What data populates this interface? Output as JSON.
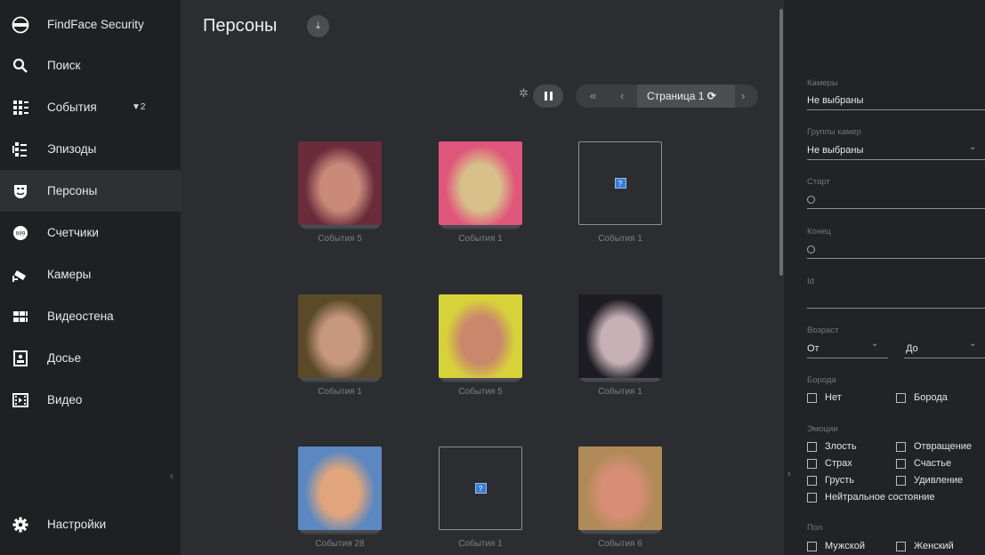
{
  "app": {
    "title": "FindFace Security"
  },
  "sidebar": {
    "items": [
      {
        "label": "Поиск",
        "icon": "search-icon"
      },
      {
        "label": "События",
        "icon": "events-icon",
        "badge": "▼2"
      },
      {
        "label": "Эпизоды",
        "icon": "episodes-icon"
      },
      {
        "label": "Персоны",
        "icon": "persons-icon"
      },
      {
        "label": "Счетчики",
        "icon": "counters-icon"
      },
      {
        "label": "Камеры",
        "icon": "camera-icon"
      },
      {
        "label": "Видеостена",
        "icon": "videowall-icon"
      },
      {
        "label": "Досье",
        "icon": "dossier-icon"
      },
      {
        "label": "Видео",
        "icon": "video-icon"
      }
    ],
    "settings": "Настройки"
  },
  "main": {
    "title": "Персоны",
    "pager": {
      "first": "«",
      "prev": "‹",
      "page": "Страница 1",
      "next": "›"
    },
    "cards": [
      {
        "caption": "События 5",
        "image": true,
        "colors": [
          "#6a2c3a",
          "#c98a7a"
        ]
      },
      {
        "caption": "События 1",
        "image": true,
        "colors": [
          "#e0567a",
          "#d8c08a"
        ]
      },
      {
        "caption": "События 1",
        "image": false
      },
      {
        "caption": "События 1",
        "image": true,
        "colors": [
          "#5a4a2a",
          "#c7987e"
        ]
      },
      {
        "caption": "События 5",
        "image": true,
        "colors": [
          "#d8d23a",
          "#c9876b"
        ]
      },
      {
        "caption": "События 1",
        "image": true,
        "colors": [
          "#1d1c22",
          "#c7b1b7"
        ]
      },
      {
        "caption": "События 28",
        "image": true,
        "colors": [
          "#5b88c0",
          "#e0a57c"
        ]
      },
      {
        "caption": "События 1",
        "image": false
      },
      {
        "caption": "События 6",
        "image": true,
        "colors": [
          "#b08a58",
          "#d88e76"
        ]
      }
    ]
  },
  "filters": {
    "cameras_label": "Камеры",
    "cameras_value": "Не выбраны",
    "camera_groups_label": "Группы камер",
    "camera_groups_value": "Не выбраны",
    "start_label": "Старт",
    "end_label": "Конец",
    "id_label": "Id",
    "age_label": "Возраст",
    "age_from": "От",
    "age_to": "До",
    "beard_label": "Борода",
    "beard_options": [
      "Нет",
      "Борода"
    ],
    "emotions_label": "Эмоции",
    "emotions": [
      "Злость",
      "Отвращение",
      "Страх",
      "Счастье",
      "Грусть",
      "Удивление",
      "Нейтральное состояние"
    ],
    "gender_label": "Пол",
    "gender_options": [
      "Мужской",
      "Женский"
    ]
  }
}
